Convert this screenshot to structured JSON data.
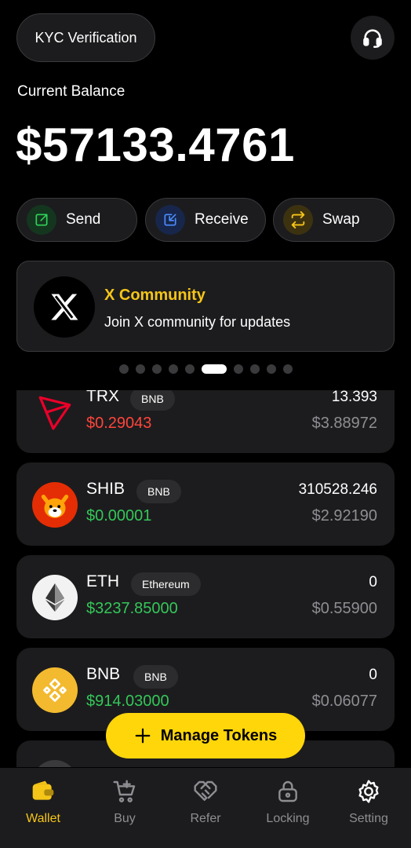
{
  "header": {
    "kyc_label": "KYC Verification",
    "support_icon": "headset-icon"
  },
  "balance": {
    "label": "Current Balance",
    "value": "$57133.4761"
  },
  "actions": [
    {
      "label": "Send",
      "icon": "send-arrow-icon",
      "color": "#30d158",
      "bg": "#14361f"
    },
    {
      "label": "Receive",
      "icon": "receive-arrow-icon",
      "color": "#4c8dff",
      "bg": "#17264a"
    },
    {
      "label": "Swap",
      "icon": "swap-icon",
      "color": "#f5c518",
      "bg": "#3d3210"
    }
  ],
  "banner": {
    "title": "X Community",
    "subtitle": "Join X community for updates",
    "icon": "x-logo-icon"
  },
  "carousel": {
    "count": 10,
    "active": 5
  },
  "tokens": [
    {
      "symbol": "TRX",
      "network": "BNB",
      "price": "$0.29043",
      "price_trend": "down",
      "amount": "13.393",
      "value": "$3.88972",
      "icon": "trx-icon"
    },
    {
      "symbol": "SHIB",
      "network": "BNB",
      "price": "$0.00001",
      "price_trend": "up",
      "amount": "310528.246",
      "value": "$2.92190",
      "icon": "shib-icon"
    },
    {
      "symbol": "ETH",
      "network": "Ethereum",
      "price": "$3237.85000",
      "price_trend": "up",
      "amount": "0",
      "value": "$0.55900",
      "icon": "eth-icon"
    },
    {
      "symbol": "BNB",
      "network": "BNB",
      "price": "$914.03000",
      "price_trend": "up",
      "amount": "0",
      "value": "$0.06077",
      "icon": "bnb-icon"
    }
  ],
  "manage_tokens": {
    "label": "Manage Tokens"
  },
  "tabs": [
    {
      "label": "Wallet",
      "icon": "wallet-icon",
      "active": true
    },
    {
      "label": "Buy",
      "icon": "cart-icon",
      "active": false
    },
    {
      "label": "Refer",
      "icon": "handshake-icon",
      "active": false
    },
    {
      "label": "Locking",
      "icon": "lock-icon",
      "active": false
    },
    {
      "label": "Setting",
      "icon": "gear-icon",
      "active": false
    }
  ],
  "colors": {
    "accent": "#f5c518",
    "up": "#34c759",
    "down": "#ff453a",
    "card": "#1c1c1e"
  }
}
